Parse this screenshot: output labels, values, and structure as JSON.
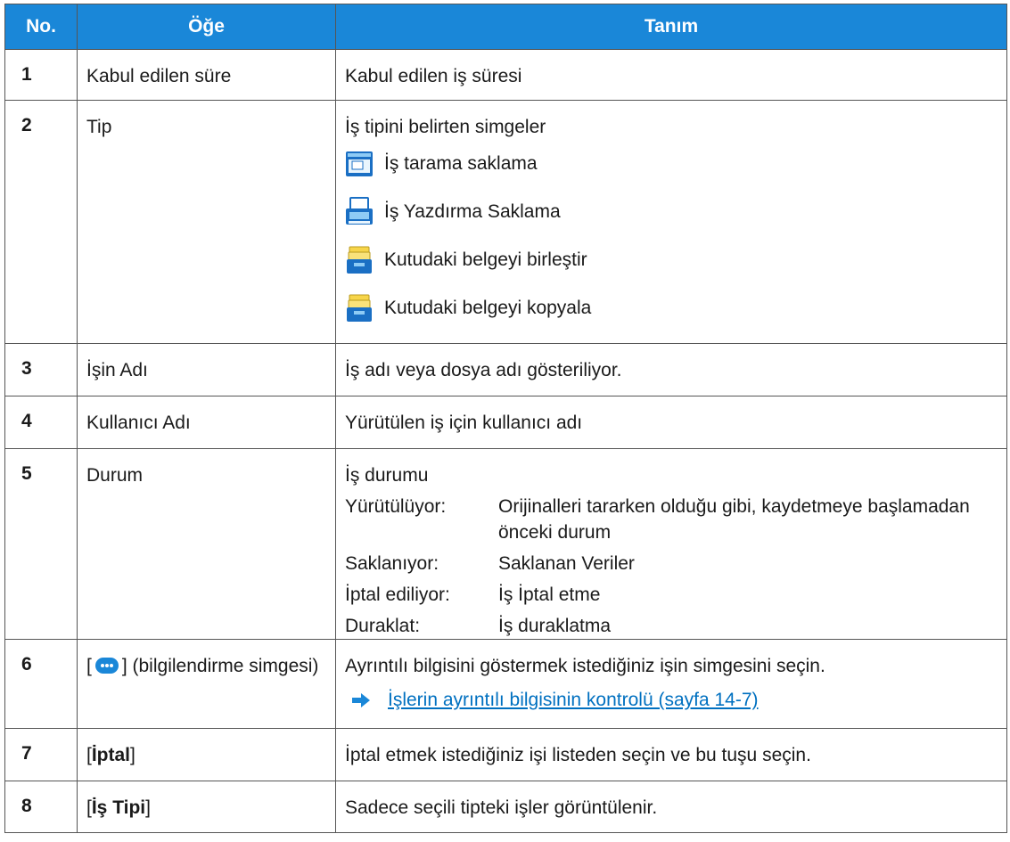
{
  "header": {
    "col1": "No.",
    "col2": "Öğe",
    "col3": "Tanım"
  },
  "colors": {
    "header_bg": "#1a87d8",
    "link": "#0070c0"
  },
  "rows": [
    {
      "no": "1",
      "item": "Kabul edilen süre",
      "desc": "Kabul edilen iş süresi"
    },
    {
      "no": "2",
      "item": "Tip",
      "desc": "İş tipini belirten simgeler",
      "icons": [
        {
          "icon": "scan-storage-icon",
          "label": "İş tarama saklama"
        },
        {
          "icon": "print-storage-icon",
          "label": " İş Yazdırma Saklama"
        },
        {
          "icon": "box-merge-icon",
          "label": "Kutudaki belgeyi birleştir"
        },
        {
          "icon": "box-copy-icon",
          "label": "Kutudaki belgeyi kopyala"
        }
      ]
    },
    {
      "no": "3",
      "item": "İşin Adı",
      "desc": "İş adı veya dosya adı gösteriliyor."
    },
    {
      "no": "4",
      "item": "Kullanıcı Adı",
      "desc": "Yürütülen iş için kullanıcı adı"
    },
    {
      "no": "5",
      "item": "Durum",
      "desc": "İş durumu",
      "statuses": [
        {
          "label": "Yürütülüyor:",
          "value": "Orijinalleri tararken olduğu gibi, kaydetmeye başlamadan önceki durum"
        },
        {
          "label": "Saklanıyor:",
          "value": "Saklanan Veriler"
        },
        {
          "label": "İptal ediliyor:",
          "value": "İş İptal etme"
        },
        {
          "label": "Duraklat:",
          "value": "İş duraklatma"
        }
      ]
    },
    {
      "no": "6",
      "item_open": "[",
      "item_close": "] (bilgilendirme simgesi)",
      "desc": "Ayrıntılı bilgisini göstermek istediğiniz işin simgesini seçin.",
      "link": "İşlerin ayrıntılı bilgisinin kontrolü (sayfa 14-7)"
    },
    {
      "no": "7",
      "item_bold": "İptal",
      "desc": "İptal etmek istediğiniz işi listeden seçin ve bu tuşu seçin."
    },
    {
      "no": "8",
      "item_bold": "İş Tipi",
      "desc": "Sadece seçili tipteki işler görüntülenir."
    }
  ]
}
